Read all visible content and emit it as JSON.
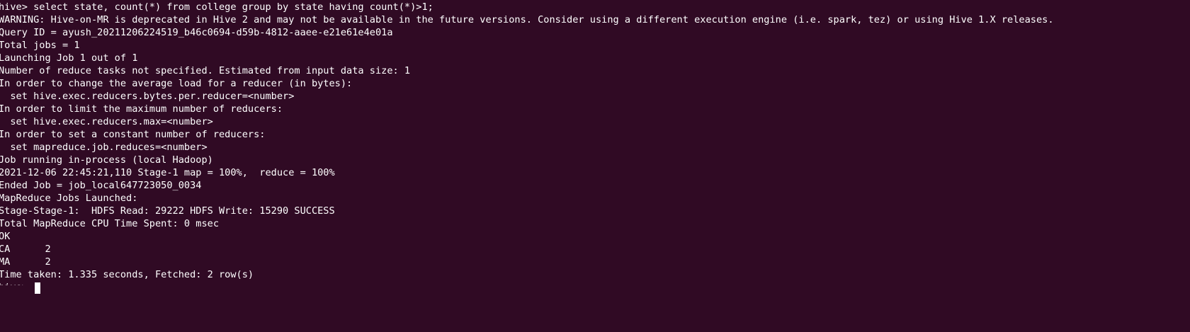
{
  "terminal": {
    "lines": [
      "hive> select state, count(*) from college group by state having count(*)>1;",
      "WARNING: Hive-on-MR is deprecated in Hive 2 and may not be available in the future versions. Consider using a different execution engine (i.e. spark, tez) or using Hive 1.X releases.",
      "Query ID = ayush_20211206224519_b46c0694-d59b-4812-aaee-e21e61e4e01a",
      "Total jobs = 1",
      "Launching Job 1 out of 1",
      "Number of reduce tasks not specified. Estimated from input data size: 1",
      "In order to change the average load for a reducer (in bytes):",
      "  set hive.exec.reducers.bytes.per.reducer=<number>",
      "In order to limit the maximum number of reducers:",
      "  set hive.exec.reducers.max=<number>",
      "In order to set a constant number of reducers:",
      "  set mapreduce.job.reduces=<number>",
      "Job running in-process (local Hadoop)",
      "2021-12-06 22:45:21,110 Stage-1 map = 100%,  reduce = 100%",
      "Ended Job = job_local647723050_0034",
      "MapReduce Jobs Launched:",
      "Stage-Stage-1:  HDFS Read: 29222 HDFS Write: 15290 SUCCESS",
      "Total MapReduce CPU Time Spent: 0 msec",
      "OK",
      "CA      2",
      "MA      2",
      "Time taken: 1.335 seconds, Fetched: 2 row(s)"
    ],
    "prompt": "hive> "
  }
}
